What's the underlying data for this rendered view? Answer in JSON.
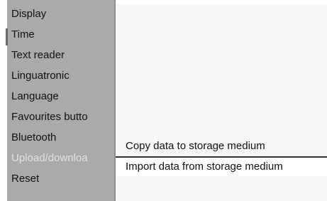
{
  "menu": {
    "items": [
      {
        "label": "Display"
      },
      {
        "label": "Time"
      },
      {
        "label": "Text reader"
      },
      {
        "label": "Linguatronic"
      },
      {
        "label": "Language"
      },
      {
        "label": "Favourites butto"
      },
      {
        "label": "Bluetooth"
      },
      {
        "label": "Upload/downloa",
        "selected": true
      },
      {
        "label": "Reset"
      }
    ]
  },
  "submenu": {
    "items": [
      {
        "label": "Copy data to storage medium"
      },
      {
        "label": "Import data from storage medium",
        "highlighted": true
      }
    ]
  },
  "colors": {
    "sidebar_bg": "#aaaaaa",
    "content_bg": "#f7f7f7",
    "selected_text": "#e2e2e2",
    "highlight_border": "#333333"
  }
}
